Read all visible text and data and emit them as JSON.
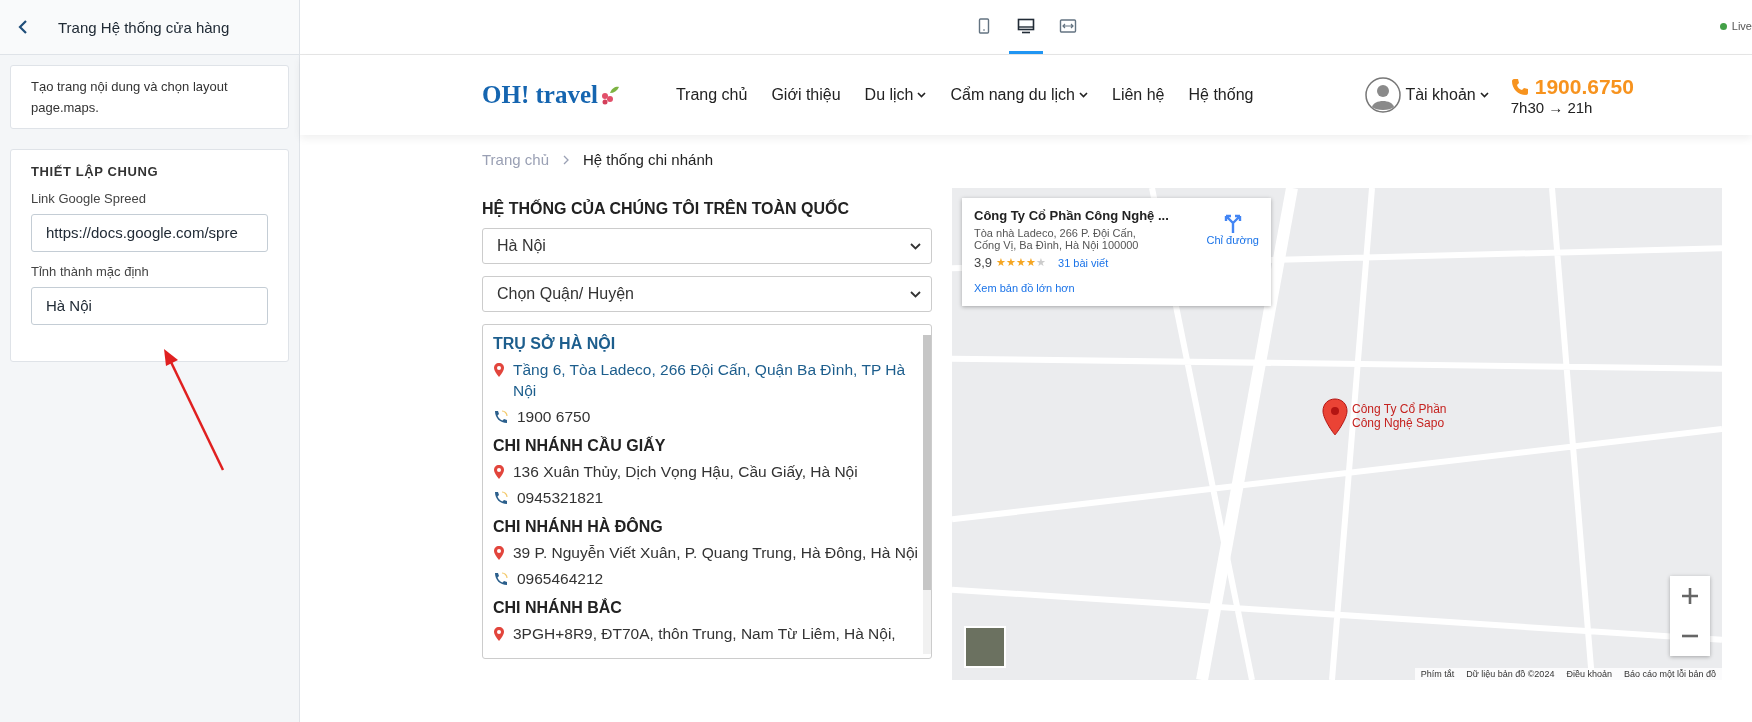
{
  "sidebar": {
    "title": "Trang Hệ thống cửa hàng",
    "description": "Tạo trang nội dung và chọn layout page.maps.",
    "section": {
      "heading": "THIẾT LẬP CHUNG",
      "fields": [
        {
          "label": "Link Google Spreed",
          "value": "https://docs.google.com/spre"
        },
        {
          "label": "Tỉnh thành mặc định",
          "value": "Hà Nội"
        }
      ]
    }
  },
  "toolbar": {
    "devices": [
      {
        "kind": "mobile",
        "selected": false
      },
      {
        "kind": "desktop",
        "selected": true
      },
      {
        "kind": "fullwidth",
        "selected": false
      }
    ],
    "status": "Live"
  },
  "site_header": {
    "logo": "OH! travel",
    "nav": [
      {
        "label": "Trang chủ",
        "dropdown": false
      },
      {
        "label": "Giới thiệu",
        "dropdown": false
      },
      {
        "label": "Du lịch",
        "dropdown": true
      },
      {
        "label": "Cẩm nang du lịch",
        "dropdown": true
      },
      {
        "label": "Liên hệ",
        "dropdown": false
      },
      {
        "label": "Hệ thống",
        "dropdown": false
      }
    ],
    "account": "Tài khoản",
    "hotline": "1900.6750",
    "hours": "7h30 → 21h"
  },
  "breadcrumb": [
    "Trang chủ",
    "Hệ thống chi nhánh"
  ],
  "heading": "HỆ THỐNG CỦA CHÚNG TÔI TRÊN TOÀN QUỐC",
  "province_select": "Hà Nội",
  "district_select": "Chọn Quận/ Huyện",
  "branches": [
    {
      "name": "TRỤ SỞ HÀ NỘI",
      "address": "Tầng 6, Tòa Ladeco, 266 Đội Cấn, Quận Ba Đình, TP Hà Nội",
      "phone": "1900 6750",
      "selected": true
    },
    {
      "name": "CHI NHÁNH CẦU GIẤY",
      "address": "136 Xuân Thủy, Dịch Vọng Hậu, Cầu Giấy, Hà Nội",
      "phone": "0945321821",
      "selected": false
    },
    {
      "name": "CHI NHÁNH HÀ ĐÔNG",
      "address": "39 P. Nguyễn Viết Xuân, P. Quang Trung, Hà Đông, Hà Nội",
      "phone": "0965464212",
      "selected": false
    },
    {
      "name": "CHI NHÁNH BẮC",
      "address": "3PGH+8R9, ĐT70A, thôn Trung, Nam Từ Liêm, Hà Nội,",
      "selected": false
    }
  ],
  "map": {
    "info_card": {
      "title": "Công Ty Cổ Phần Công Nghệ ...",
      "address_lines": [
        "Tòa nhà Ladeco, 266 P. Đội Cấn,",
        "Cống Vị, Ba Đình, Hà Nội 100000"
      ],
      "rating": "3,9",
      "stars": 4,
      "reviews": "31 bài viết",
      "link": "Xem bản đồ lớn hơn",
      "directions": "Chỉ đường"
    },
    "marker_label": "Công Ty Cổ Phần Công Nghệ Sapo",
    "footer": [
      "Phím tắt",
      "Dữ liệu bản đồ ©2024",
      "Điều khoản",
      "Báo cáo một lỗi bản đồ"
    ]
  }
}
